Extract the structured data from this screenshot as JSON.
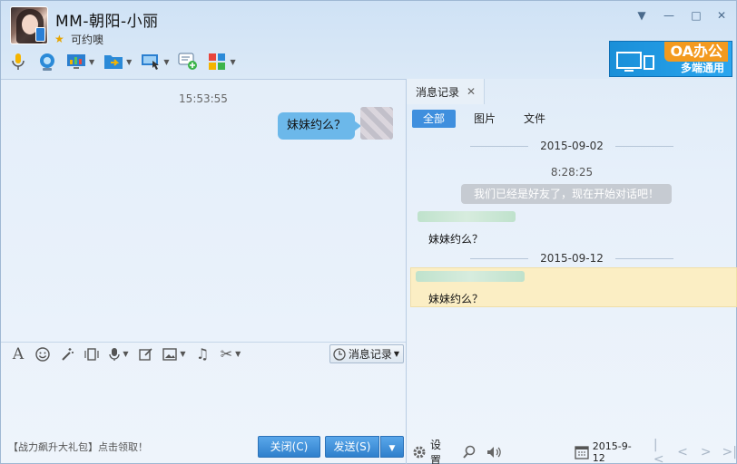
{
  "contact": {
    "name": "MM-朝阳-小丽",
    "status": "可约噢"
  },
  "window": {
    "minimize": "—",
    "maximize": "□",
    "close": "✕",
    "dropdown": "▼"
  },
  "toolbar": {
    "items": [
      {
        "icon": "microphone-icon"
      },
      {
        "icon": "video-camera-icon"
      },
      {
        "icon": "screen-share-icon"
      },
      {
        "icon": "folder-transfer-icon"
      },
      {
        "icon": "remote-desktop-icon"
      },
      {
        "icon": "add-chat-icon"
      },
      {
        "icon": "apps-grid-icon"
      }
    ]
  },
  "ad": {
    "title": "OA办公",
    "subtitle": "多端通用"
  },
  "chat": {
    "time": "15:53:55",
    "my_message": "妹妹约么？"
  },
  "input_toolbar": {
    "history_label": "消息记录"
  },
  "footer": {
    "promo": "【战力飙升大礼包】点击领取！",
    "close_label": "关闭(C)",
    "send_label": "发送(S)"
  },
  "history": {
    "tab_label": "消息记录",
    "filters": [
      "全部",
      "图片",
      "文件"
    ],
    "date1": "2015-09-02",
    "time1": "8:28:25",
    "system_msg": "我们已经是好友了，现在开始对话吧！",
    "msg1": "妹妹约么？",
    "date2": "2015-09-12",
    "msg2": "妹妹约么？",
    "settings_label": "设置",
    "current_date": "2015-9-12"
  },
  "colors": {
    "accent": "#3f8fde",
    "bubble": "#6cb8ea",
    "highlight": "#fbeec4"
  }
}
